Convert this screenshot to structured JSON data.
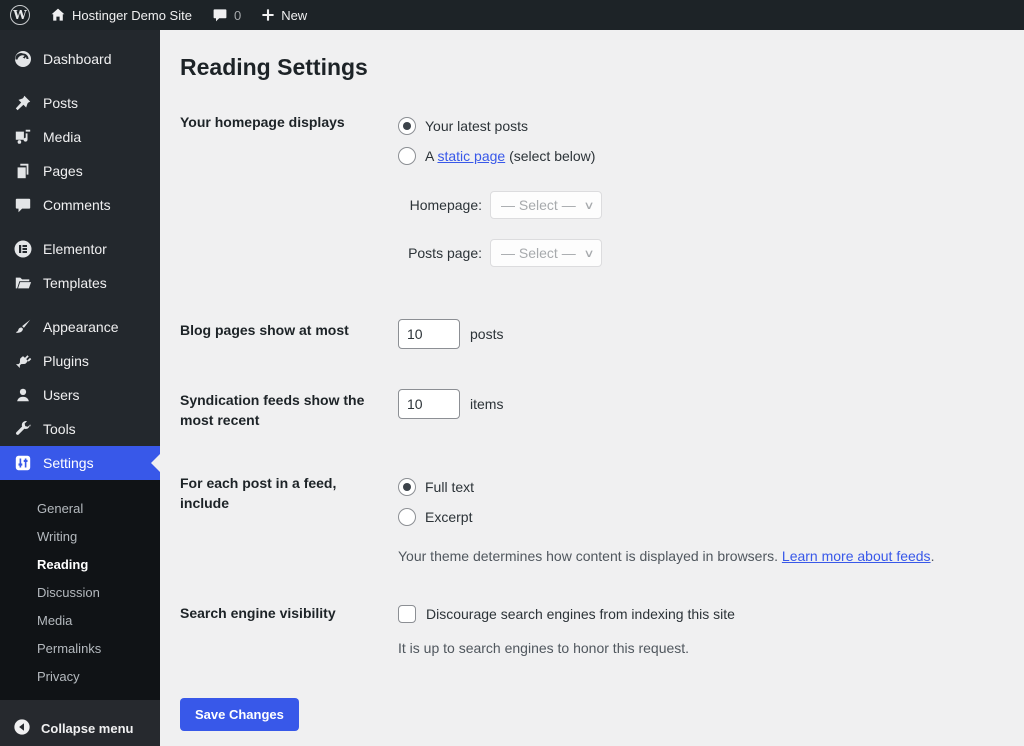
{
  "admin_bar": {
    "site_name": "Hostinger Demo Site",
    "comments_count": "0",
    "new_label": "New",
    "wp_logo_letter": "W"
  },
  "sidebar": {
    "items": [
      {
        "label": "Dashboard",
        "icon": "dashboard-icon"
      },
      {
        "label": "Posts",
        "icon": "pin-icon"
      },
      {
        "label": "Media",
        "icon": "media-icon"
      },
      {
        "label": "Pages",
        "icon": "pages-icon"
      },
      {
        "label": "Comments",
        "icon": "comment-icon"
      },
      {
        "label": "Elementor",
        "icon": "elementor-icon"
      },
      {
        "label": "Templates",
        "icon": "folder-icon"
      },
      {
        "label": "Appearance",
        "icon": "brush-icon"
      },
      {
        "label": "Plugins",
        "icon": "plug-icon"
      },
      {
        "label": "Users",
        "icon": "user-icon"
      },
      {
        "label": "Tools",
        "icon": "wrench-icon"
      },
      {
        "label": "Settings",
        "icon": "sliders-icon",
        "active": true
      }
    ],
    "submenu": {
      "items": [
        {
          "label": "General"
        },
        {
          "label": "Writing"
        },
        {
          "label": "Reading",
          "current": true
        },
        {
          "label": "Discussion"
        },
        {
          "label": "Media"
        },
        {
          "label": "Permalinks"
        },
        {
          "label": "Privacy"
        }
      ]
    },
    "collapse_label": "Collapse menu"
  },
  "main": {
    "title": "Reading Settings",
    "homepage_row": {
      "label": "Your homepage displays",
      "option_latest": "Your latest posts",
      "option_static_prefix": "A ",
      "option_static_link": "static page",
      "option_static_suffix": " (select below)",
      "homepage_label": "Homepage:",
      "posts_page_label": "Posts page:",
      "select_placeholder": "— Select —"
    },
    "blog_row": {
      "label": "Blog pages show at most",
      "value": "10",
      "suffix": "posts"
    },
    "syndication_row": {
      "label": "Syndication feeds show the most recent",
      "value": "10",
      "suffix": "items"
    },
    "feed_row": {
      "label": "For each post in a feed, include",
      "option_full": "Full text",
      "option_excerpt": "Excerpt",
      "description": "Your theme determines how content is displayed in browsers. ",
      "description_link": "Learn more about feeds",
      "description_suffix": "."
    },
    "search_row": {
      "label": "Search engine visibility",
      "checkbox_label": "Discourage search engines from indexing this site",
      "description": "It is up to search engines to honor this request."
    },
    "save_button": "Save Changes"
  },
  "colors": {
    "accent": "#3858e9",
    "link": "#3858e9",
    "admin_bar_bg": "#1d2327",
    "menu_bg": "#23282d",
    "submenu_bg": "#101316",
    "content_bg": "#f0f0f1"
  }
}
